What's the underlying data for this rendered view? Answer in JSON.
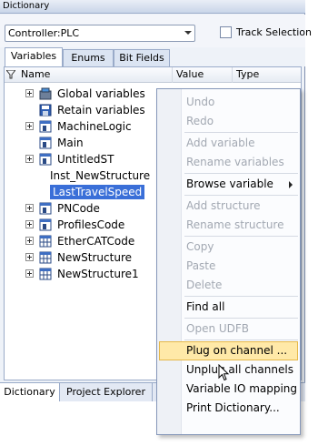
{
  "window": {
    "title": "Dictionary"
  },
  "toolbar": {
    "controller_value": "Controller:PLC",
    "track_selection_label": "Track Selection",
    "track_selection_checked": false
  },
  "tabs": [
    {
      "label": "Variables",
      "active": true
    },
    {
      "label": "Enums",
      "active": false
    },
    {
      "label": "Bit Fields",
      "active": false
    }
  ],
  "columns": {
    "name": "Name",
    "value": "Value",
    "type": "Type"
  },
  "tree": [
    {
      "label": "Global variables",
      "icon": "global-variables-icon",
      "expandable": true,
      "indent": 0
    },
    {
      "label": "Retain variables",
      "icon": "save-disk-icon",
      "expandable": false,
      "indent": 0
    },
    {
      "label": "MachineLogic",
      "icon": "program-icon",
      "expandable": true,
      "indent": 0
    },
    {
      "label": "Main",
      "icon": "program-icon",
      "expandable": false,
      "indent": 0
    },
    {
      "label": "UntitledST",
      "icon": "program-icon",
      "expandable": true,
      "indent": 0
    },
    {
      "label": "Inst_NewStructure",
      "icon": "",
      "expandable": false,
      "indent": 1
    },
    {
      "label": "LastTravelSpeed",
      "icon": "",
      "expandable": false,
      "indent": 1,
      "selected": true
    },
    {
      "label": "PNCode",
      "icon": "program-icon",
      "expandable": true,
      "indent": 0
    },
    {
      "label": "ProfilesCode",
      "icon": "program-icon",
      "expandable": true,
      "indent": 0
    },
    {
      "label": "EtherCATCode",
      "icon": "grid-icon",
      "expandable": true,
      "indent": 0
    },
    {
      "label": "NewStructure",
      "icon": "grid-icon",
      "expandable": true,
      "indent": 0
    },
    {
      "label": "NewStructure1",
      "icon": "grid-icon",
      "expandable": true,
      "indent": 0
    }
  ],
  "bottom_tabs": [
    {
      "label": "Dictionary",
      "active": true
    },
    {
      "label": "Project Explorer",
      "active": false
    }
  ],
  "context_menu": {
    "items": [
      {
        "label": "Undo",
        "enabled": false
      },
      {
        "label": "Redo",
        "enabled": false
      },
      {
        "label": "Add variable",
        "enabled": false
      },
      {
        "label": "Rename variables",
        "enabled": false
      },
      {
        "label": "Browse variable",
        "enabled": true,
        "submenu": true
      },
      {
        "label": "Add structure",
        "enabled": false
      },
      {
        "label": "Rename structure",
        "enabled": false
      },
      {
        "label": "Copy",
        "enabled": false
      },
      {
        "label": "Paste",
        "enabled": false
      },
      {
        "label": "Delete",
        "enabled": false
      },
      {
        "label": "Find all",
        "enabled": true
      },
      {
        "label": "Open UDFB",
        "enabled": false
      },
      {
        "label": "Plug on channel ...",
        "enabled": true,
        "highlighted": true
      },
      {
        "label": "Unplug all channels",
        "enabled": true
      },
      {
        "label": "Variable IO mapping",
        "enabled": true
      },
      {
        "label": "Print Dictionary...",
        "enabled": true
      }
    ]
  },
  "colors": {
    "selection": "#3a6fd8",
    "menu_highlight": "#ffe9a8",
    "disabled_text": "#a2a8b2"
  }
}
